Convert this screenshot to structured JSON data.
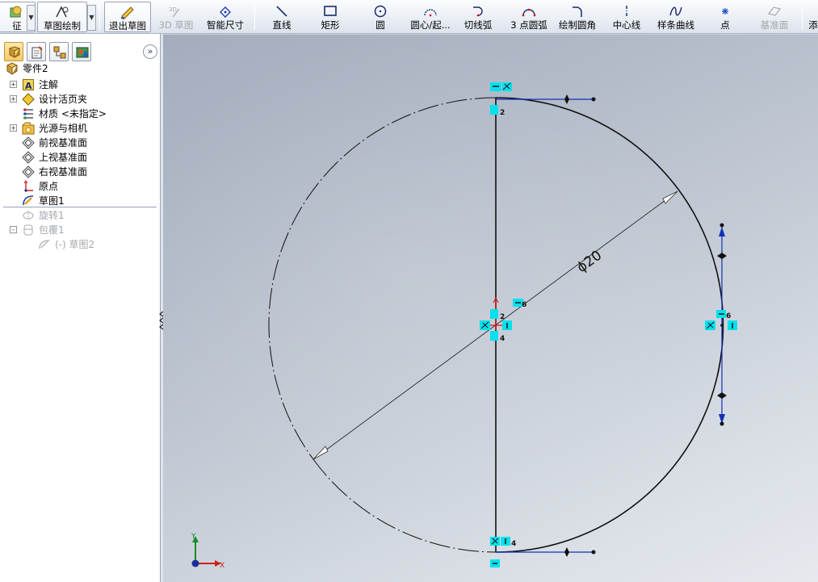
{
  "toolbar": {
    "features_label": "征",
    "sketch_label": "草图绘制",
    "exit_sketch_label": "退出草图",
    "sketch3d_label": "3D 草图",
    "smart_dim_label": "智能尺寸",
    "line_label": "直线",
    "rect_label": "矩形",
    "circle_label": "圆",
    "center_arc_label": "圆心/起...",
    "tangent_arc_label": "切线弧",
    "three_pt_arc_label": "3 点圆弧",
    "fillet_label": "绘制圆角",
    "centerline_label": "中心线",
    "spline_label": "样条曲线",
    "point_label": "点",
    "plane_label": "基准面",
    "overflow_label": "添"
  },
  "feature_tree": {
    "root": "零件2",
    "items": [
      {
        "label": "注解",
        "expander": "+"
      },
      {
        "label": "设计活页夹",
        "expander": "+"
      },
      {
        "label": "材质 <未指定>",
        "expander": ""
      },
      {
        "label": "光源与相机",
        "expander": "+"
      },
      {
        "label": "前视基准面",
        "expander": ""
      },
      {
        "label": "上视基准面",
        "expander": ""
      },
      {
        "label": "右视基准面",
        "expander": ""
      },
      {
        "label": "原点",
        "expander": ""
      },
      {
        "label": "草图1",
        "expander": ""
      },
      {
        "label": "旋转1",
        "expander": ""
      },
      {
        "label": "包覆1",
        "expander": "-"
      },
      {
        "label": "(-) 草图2",
        "expander": ""
      }
    ]
  },
  "sketch": {
    "dimension_text": "ϕ20",
    "relation_numbers": [
      "2",
      "2",
      "4",
      "6",
      "6",
      "4"
    ],
    "triad_x": "X",
    "triad_y": "Y",
    "colors": {
      "geometry": "#000000",
      "dimension": "#2a2a2a",
      "handle": "#1230b8",
      "relation_bg": "#00e1ee",
      "origin": "#e01010"
    }
  }
}
